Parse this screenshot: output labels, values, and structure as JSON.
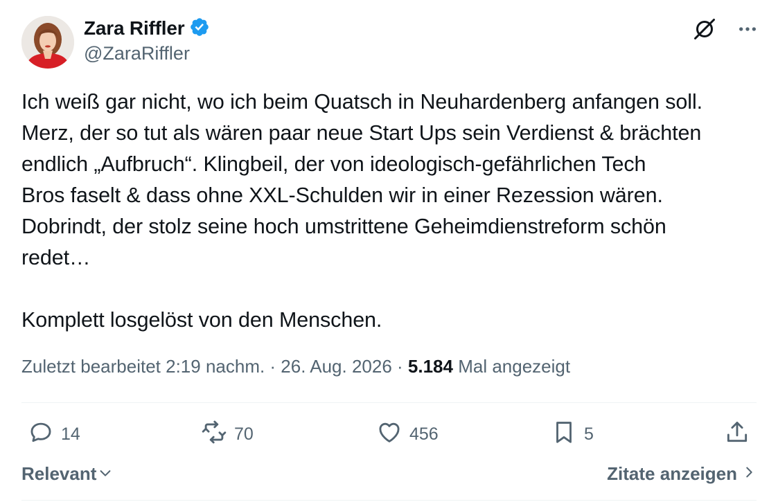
{
  "author": {
    "name": "Zara Riffler",
    "handle": "@ZaraRiffler",
    "verified": true
  },
  "tweet": {
    "text": "Ich weiß gar nicht, wo ich beim Quatsch in Neuhardenberg anfangen soll.\nMerz, der so tut als wären paar neue Start Ups sein Verdienst & brächten\nendlich „Aufbruch“. Klingbeil, der von ideologisch-gefährlichen Tech\nBros faselt & dass ohne XXL-Schulden wir in einer Rezession wären.\nDobrindt, der stolz seine hoch umstrittene Geheimdienstreform schön\nredet…\n\nKomplett losgelöst von den Menschen."
  },
  "meta": {
    "edited_prefix": "Zuletzt bearbeitet 2:19 nachm. · 26. Aug. 2026 · ",
    "views_count": "5.184",
    "views_label": " Mal angezeigt"
  },
  "actions": {
    "replies": "14",
    "reposts": "70",
    "likes": "456",
    "bookmarks": "5"
  },
  "footer": {
    "sort_label": "Relevant",
    "quotes_label": "Zitate anzeigen"
  },
  "colors": {
    "text": "#0f1419",
    "secondary": "#536471",
    "verified": "#1d9bf0",
    "divider": "#eff3f4"
  },
  "icons": [
    "verified-badge-icon",
    "grok-icon",
    "more-icon",
    "reply-icon",
    "repost-icon",
    "like-icon",
    "bookmark-icon",
    "share-icon",
    "chevron-down-icon",
    "chevron-right-icon"
  ]
}
